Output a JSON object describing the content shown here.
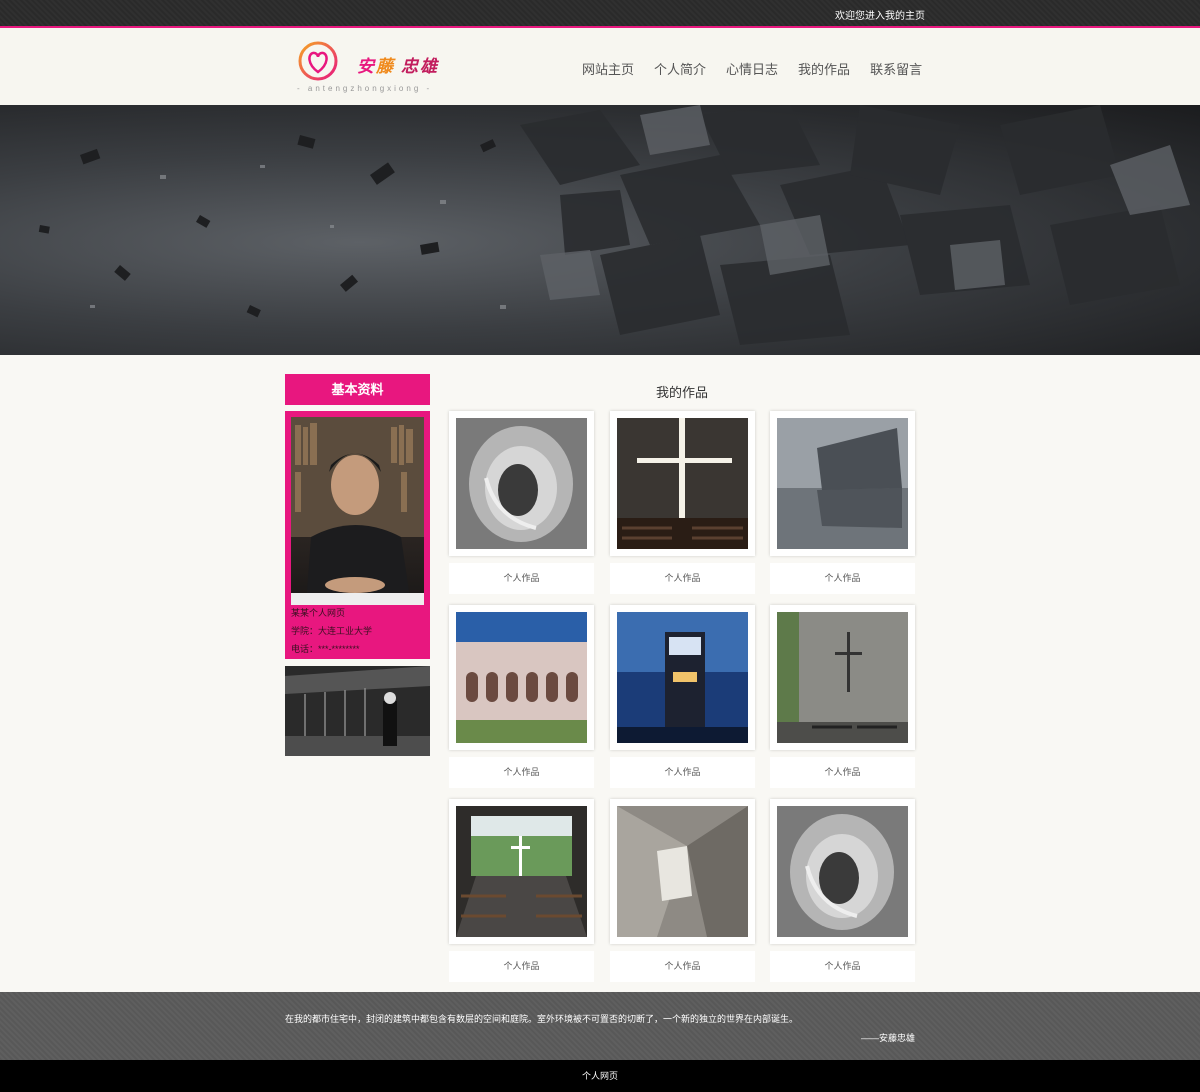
{
  "topbar": {
    "welcome": "欢迎您进入我的主页"
  },
  "header": {
    "logo": {
      "cn_a": "安",
      "cn_b": "藤",
      "cn_c": "忠雄",
      "pinyin": "- antengzhongxiong -"
    },
    "nav": [
      "网站主页",
      "个人简介",
      "心情日志",
      "我的作品",
      "联系留言"
    ]
  },
  "colors": {
    "accent": "#e8177f",
    "topbar": "#2b2b2b",
    "footer": "#5a5a5a"
  },
  "sidebar": {
    "title": "基本资料",
    "lines": [
      "某某个人网页",
      "学院：大连工业大学",
      "电话：***-********"
    ]
  },
  "works": {
    "title": "我的作品",
    "caption": "个人作品",
    "items": [
      {
        "caption": "个人作品"
      },
      {
        "caption": "个人作品"
      },
      {
        "caption": "个人作品"
      },
      {
        "caption": "个人作品"
      },
      {
        "caption": "个人作品"
      },
      {
        "caption": "个人作品"
      },
      {
        "caption": "个人作品"
      },
      {
        "caption": "个人作品"
      },
      {
        "caption": "个人作品"
      }
    ]
  },
  "footer": {
    "quote": "在我的都市住宅中，封闭的建筑中都包含有数层的空间和庭院。室外环境被不可置否的切断了，一个新的独立的世界在内部诞生。",
    "author": "——安藤忠雄",
    "copyright": "个人网页"
  }
}
